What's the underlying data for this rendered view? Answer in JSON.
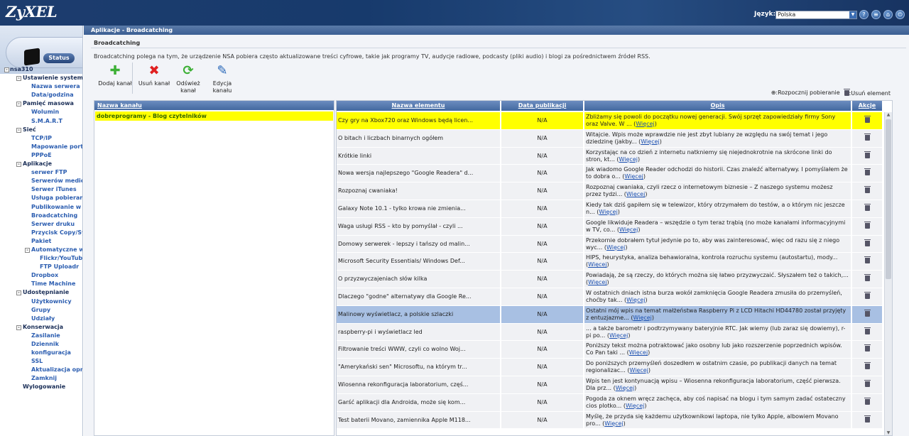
{
  "header": {
    "logo": "ZyXEL",
    "language_label": "Język:",
    "language_value": "Polska",
    "icons": [
      "help-icon",
      "sitemap-icon",
      "home-icon",
      "logout-icon"
    ]
  },
  "sidebar": {
    "status_label": "Status",
    "tree": [
      {
        "level": 0,
        "label": "nsa310",
        "toggle": "-"
      },
      {
        "level": 1,
        "label": "Ustawienie systemu",
        "toggle": "-"
      },
      {
        "level": 2,
        "label": "Nazwa serwera"
      },
      {
        "level": 2,
        "label": "Data/godzina"
      },
      {
        "level": 1,
        "label": "Pamięć masowa",
        "toggle": "-"
      },
      {
        "level": 2,
        "label": "Wolumin"
      },
      {
        "level": 2,
        "label": "S.M.A.R.T"
      },
      {
        "level": 1,
        "label": "Sieć",
        "toggle": "-"
      },
      {
        "level": 2,
        "label": "TCP/IP"
      },
      {
        "level": 2,
        "label": "Mapowanie portów"
      },
      {
        "level": 2,
        "label": "PPPoE"
      },
      {
        "level": 1,
        "label": "Aplikacje",
        "toggle": "-"
      },
      {
        "level": 2,
        "label": "serwer FTP"
      },
      {
        "level": 2,
        "label": "Serwerów mediów"
      },
      {
        "level": 2,
        "label": "Serwer iTunes"
      },
      {
        "level": 2,
        "label": "Usługa pobierania"
      },
      {
        "level": 2,
        "label": "Publikowanie w sieci"
      },
      {
        "level": 2,
        "label": "Broadcatching"
      },
      {
        "level": 2,
        "label": "Serwer druku"
      },
      {
        "level": 2,
        "label": "Przycisk Copy/Sync"
      },
      {
        "level": 2,
        "label": "Pakiet"
      },
      {
        "level": 2,
        "label": "Automatyczne wysyłanie",
        "toggle": "-"
      },
      {
        "level": 3,
        "label": "Flickr/YouTube"
      },
      {
        "level": 3,
        "label": "FTP Uploadr"
      },
      {
        "level": 2,
        "label": "Dropbox"
      },
      {
        "level": 2,
        "label": "Time Machine"
      },
      {
        "level": 1,
        "label": "Udostępnianie",
        "toggle": "-"
      },
      {
        "level": 2,
        "label": "Użytkownicy"
      },
      {
        "level": 2,
        "label": "Grupy"
      },
      {
        "level": 2,
        "label": "Udziały"
      },
      {
        "level": 1,
        "label": "Konserwacja",
        "toggle": "-"
      },
      {
        "level": 2,
        "label": "Zasilanie"
      },
      {
        "level": 2,
        "label": "Dziennik"
      },
      {
        "level": 2,
        "label": "konfiguracja"
      },
      {
        "level": 2,
        "label": "SSL"
      },
      {
        "level": 2,
        "label": "Aktualizacja oprogramowania"
      },
      {
        "level": 2,
        "label": "Zamknij"
      },
      {
        "level": 1,
        "label": "Wylogowanie"
      }
    ]
  },
  "main": {
    "breadcrumb": "Aplikacje - Broadcatching",
    "section_title": "Broadcatching",
    "description": "Broadcatching polega na tym, że urządzenie NSA pobiera często aktualizowane treści cyfrowe, takie jak programy TV, audycje radiowe, podcasty (pliki audio) i blogi za pośrednictwem źródeł RSS.",
    "toolbar": {
      "add_label": "Dodaj kanał",
      "delete_label": "Usuń kanał",
      "refresh_label": "Odśwież kanał",
      "edit_label": "Edycja kanału"
    },
    "legend": {
      "download": ":Rozpocznij pobieranie",
      "delete": ":Usuń element"
    },
    "channels": {
      "header": "Nazwa kanału",
      "items": [
        "dobreprogramy - Blog czytelników"
      ]
    },
    "items_table": {
      "headers": {
        "name": "Nazwa elementu",
        "date": "Data publikacji",
        "desc": "Opis",
        "actions": "Akcje"
      },
      "more_label": "Więcej",
      "rows": [
        {
          "name": "Czy gry na Xbox720 oraz Windows będą licen...",
          "date": "N/A",
          "desc": "Zbliżamy się powoli do początku nowej generacji. Swój sprzęt zapowiedziały firmy Sony oraz Valve. W ...",
          "state": "highlight"
        },
        {
          "name": "O bitach i liczbach binarnych ogółem",
          "date": "N/A",
          "desc": "Witajcie. Wpis może wprawdzie nie jest zbyt lubiany ze względu na swój temat i jego dziedzinę (jakby...",
          "state": ""
        },
        {
          "name": "Krótkie linki",
          "date": "N/A",
          "desc": "Korzystając na co dzień z internetu natkniemy się niejednokrotnie na skrócone linki do stron, kt...",
          "state": ""
        },
        {
          "name": "Nowa wersja najlepszego \"Google Readera\" d...",
          "date": "N/A",
          "desc": "Jak wiadomo Google Reader odchodzi do historii. Czas znaleźć alternatywy. I pomyślałem że to dobra o...",
          "state": ""
        },
        {
          "name": "Rozpoznaj cwaniaka!",
          "date": "N/A",
          "desc": "Rozpoznaj cwaniaka, czyli rzecz o internetowym biznesie – Z naszego systemu możesz przez tydzi...",
          "state": ""
        },
        {
          "name": "Galaxy Note 10.1 - tylko krowa nie zmienia...",
          "date": "N/A",
          "desc": "Kiedy tak dziś gapiłem się w telewizor, który otrzymałem do testów, a o którym nic jeszcze n...",
          "state": ""
        },
        {
          "name": "Waga usługi RSS – kto by pomyślał - czyli ...",
          "date": "N/A",
          "desc": "Google likwiduje Readera – wszędzie o tym teraz trąbią (no może kanałami informacyjnymi w TV, co...",
          "state": ""
        },
        {
          "name": "Domowy serwerek - lepszy i tańszy od malin...",
          "date": "N/A",
          "desc": "Przekornie dobrałem tytuł jedynie po to, aby was zainteresować, więc od razu się z niego wyc...",
          "state": ""
        },
        {
          "name": "Microsoft Security Essentials/ Windows Def...",
          "date": "N/A",
          "desc": "HIPS, heurystyka, analiza behawioralna, kontrola rozruchu systemu (autostartu), mody...",
          "state": ""
        },
        {
          "name": "O przyzwyczajeniach słów kilka",
          "date": "N/A",
          "desc": "Powiadają, że są rzeczy, do których można się łatwo przyzwyczaić. Słyszałem też o takich,...",
          "state": ""
        },
        {
          "name": "Dlaczego \"godne\" alternatywy dla Google Re...",
          "date": "N/A",
          "desc": "W ostatnich dniach istna burza wokół zamknięcia Google Readera zmusiła do przemyśleń, choćby tak...",
          "state": ""
        },
        {
          "name": "Malinowy wyświetlacz, a polskie szlaczki",
          "date": "N/A",
          "desc": "Ostatni mój wpis na temat małżeństwa Raspberry Pi z LCD Hitachi HD44780 został przyjęty z entuzjazme...",
          "state": "selected"
        },
        {
          "name": "raspberry-pi i wyświetlacz led",
          "date": "N/A",
          "desc": "... a także barometr i podtrzymywany bateryjnie RTC. Jak wiemy (lub zaraz się dowiemy), r-pi po...",
          "state": ""
        },
        {
          "name": "Filtrowanie treści WWW, czyli co wolno Woj...",
          "date": "N/A",
          "desc": "Poniższy tekst można potraktować jako osobny lub jako rozszerzenie poprzednich wpisów. Co Pan taki ...",
          "state": ""
        },
        {
          "name": "\"Amerykański sen\" Microsoftu, na którym tr...",
          "date": "N/A",
          "desc": "Do poniższych przemyśleń doszedłem w ostatnim czasie, po publikacji danych na temat regionalizac...",
          "state": ""
        },
        {
          "name": "Wiosenna rekonfiguracja laboratorium, częś...",
          "date": "N/A",
          "desc": "Wpis ten jest kontynuacją wpisu – Wiosenna rekonfiguracja laboratorium, część pierwsza. Dla prz...",
          "state": ""
        },
        {
          "name": "Garść aplikacji dla Androida, może się kom...",
          "date": "N/A",
          "desc": "Pogoda za oknem wręcz zachęca, aby coś napisać na blogu i tym samym zadać ostateczny cios plotko...",
          "state": ""
        },
        {
          "name": "Test baterii Movano, zamiennika Apple M118...",
          "date": "N/A",
          "desc": "Myślę, że przyda się każdemu użytkownikowi laptopa, nie tylko Apple, albowiem Movano pro...",
          "state": ""
        }
      ]
    }
  },
  "colors": {
    "header_bg": "#1d3d6e",
    "highlight_row": "#ffff00",
    "selected_row": "#a8c0e3",
    "table_header": "#4e74ab",
    "link": "#1a4fb0"
  }
}
